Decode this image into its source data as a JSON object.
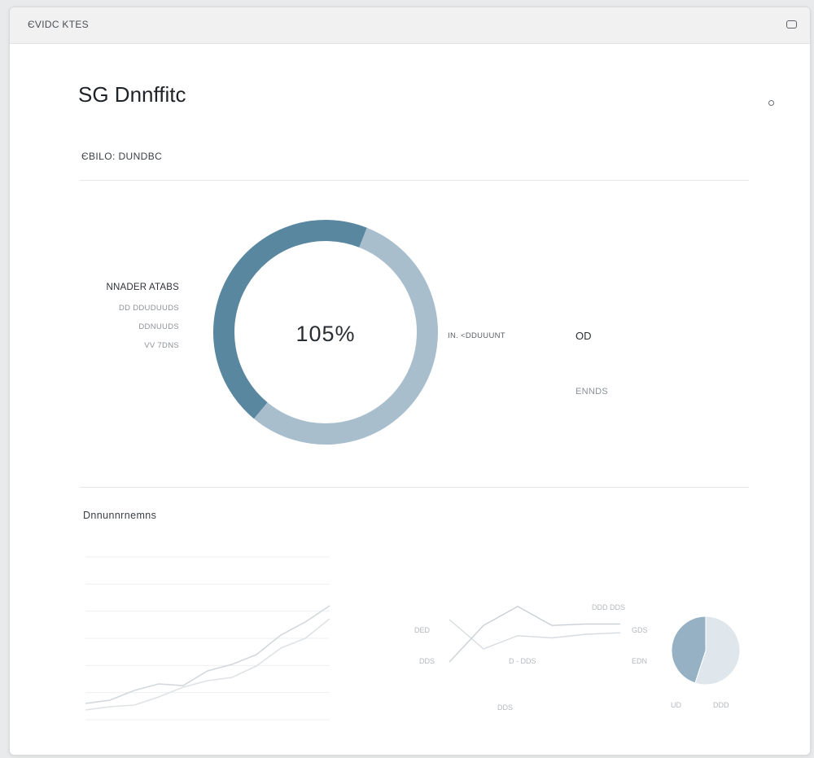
{
  "window": {
    "app_title": "ЄVIDC KTES"
  },
  "header": {
    "page_title": "SG Dnnffitc"
  },
  "overview": {
    "section_label": "ЄBILO: DUNDBC",
    "legend_title": "NNADER ATABS",
    "legend_items": [
      "DD DDUDUUDS",
      "DDNUUDS",
      "VV 7DNS"
    ],
    "donut_center": "105%",
    "stat_label": "IN. <DDUUUNT",
    "stat_value": "OD",
    "stat_sub": "ENNDS"
  },
  "trends": {
    "section_label": "Dnnunnrnemns",
    "chart_b_labels": {
      "left_top": "DED",
      "left_bottom": "DDS",
      "center_bottom": "D - DDS",
      "right_top": "GDS",
      "right_bottom": "EDN",
      "top_right": "DDD DDS",
      "bottom_center": "DDS"
    },
    "pie_labels": [
      "UD",
      "DDD"
    ]
  },
  "colors": {
    "primary": "#5a87a0",
    "secondary": "#a9becd",
    "pie_light": "#dfe7ed",
    "pie_dark": "#95b1c3",
    "line_light": "#dcdfe2"
  },
  "chart_data": [
    {
      "type": "pie",
      "title": "",
      "center_label": "105%",
      "values": [
        45,
        55
      ],
      "colors": [
        "#5a87a0",
        "#a9becd"
      ]
    },
    {
      "type": "line",
      "title": "",
      "x": [
        0,
        1,
        2,
        3,
        4,
        5,
        6,
        7,
        8,
        9,
        10
      ],
      "series": [
        {
          "values": [
            10,
            12,
            18,
            22,
            21,
            30,
            34,
            40,
            52,
            60,
            70
          ]
        },
        {
          "values": [
            6,
            8,
            9,
            14,
            20,
            24,
            26,
            33,
            44,
            50,
            62
          ]
        }
      ],
      "ylim": [
        0,
        100
      ]
    },
    {
      "type": "line",
      "title": "",
      "x": [
        0,
        1,
        2,
        3,
        4,
        5
      ],
      "series": [
        {
          "values": [
            12,
            62,
            88,
            62,
            64,
            64
          ]
        },
        {
          "values": [
            70,
            30,
            48,
            45,
            50,
            52
          ]
        }
      ],
      "ylim": [
        0,
        100
      ]
    },
    {
      "type": "pie",
      "title": "",
      "values": [
        55,
        45
      ],
      "colors": [
        "#dfe7ed",
        "#95b1c3"
      ]
    }
  ]
}
